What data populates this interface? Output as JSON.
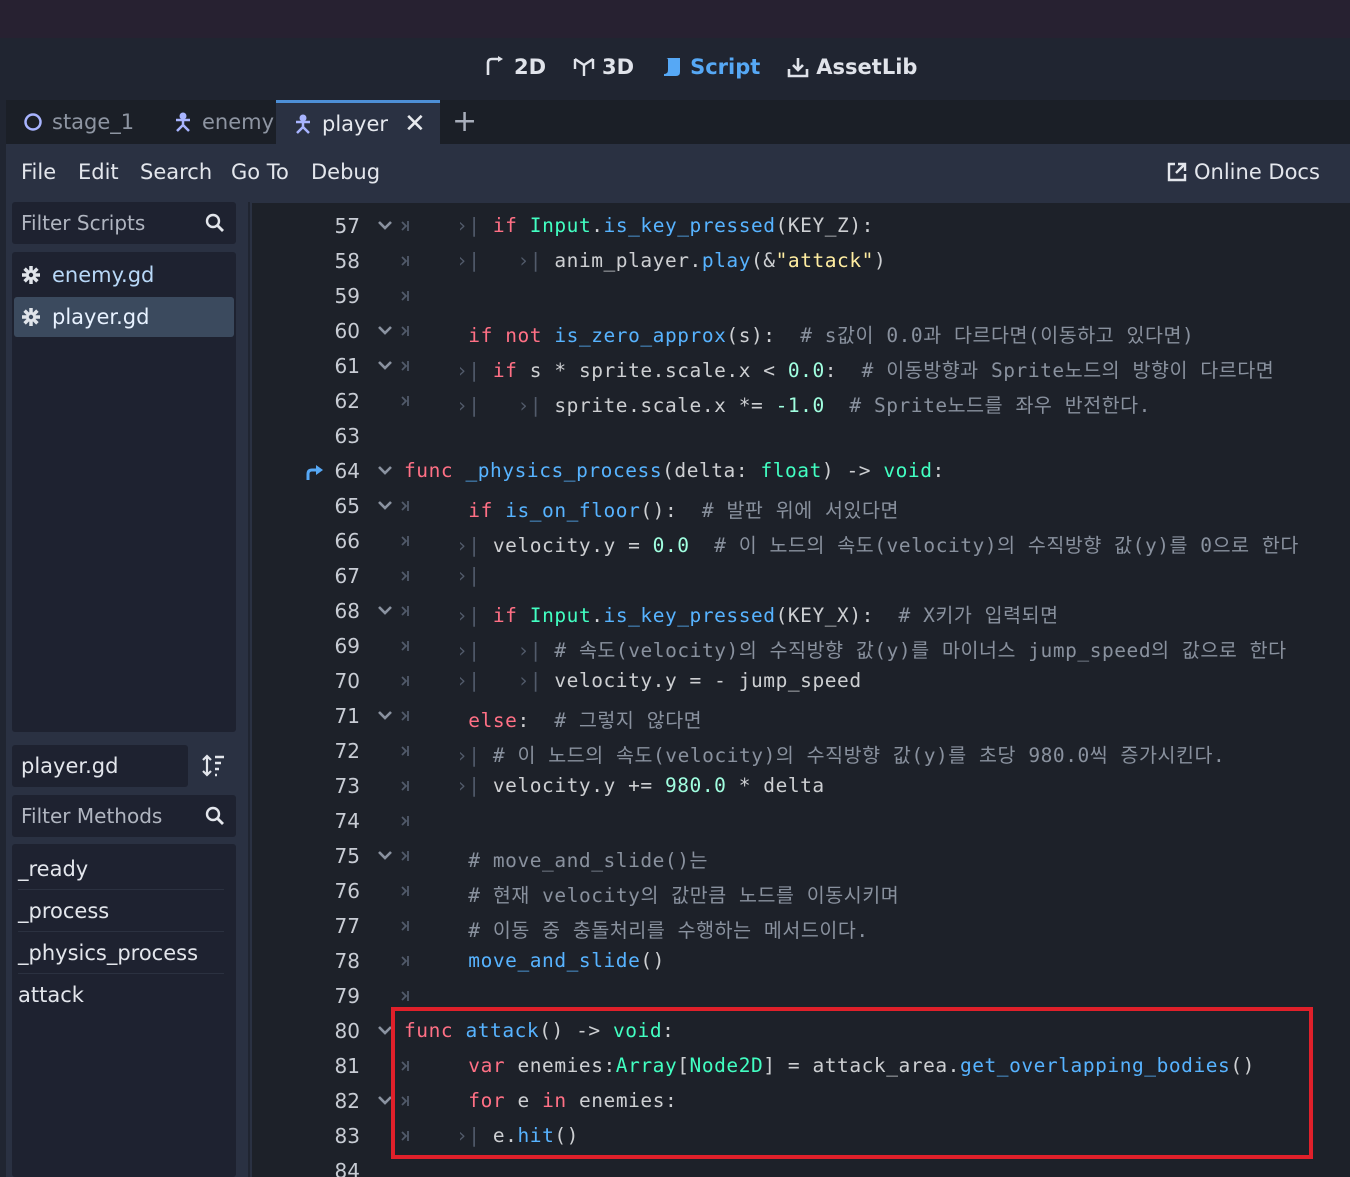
{
  "workspaces": [
    {
      "label": "2D",
      "icon": "2d-icon",
      "active": false
    },
    {
      "label": "3D",
      "icon": "3d-icon",
      "active": false
    },
    {
      "label": "Script",
      "icon": "script-icon",
      "active": true
    },
    {
      "label": "AssetLib",
      "icon": "assetlib-icon",
      "active": false
    }
  ],
  "tabs": [
    {
      "label": "stage_1",
      "icon": "node-circle-icon"
    },
    {
      "label": "enemy",
      "icon": "character-icon"
    },
    {
      "label": "player",
      "icon": "character-icon",
      "active": true,
      "close": "✕"
    }
  ],
  "tab_add": "+",
  "menu": {
    "file": "File",
    "edit": "Edit",
    "search": "Search",
    "goto": "Go To",
    "debug": "Debug",
    "online_docs": "Online Docs"
  },
  "scripts_panel": {
    "filter_placeholder": "Filter Scripts",
    "scripts": [
      {
        "name": "enemy.gd",
        "selected": false
      },
      {
        "name": "player.gd",
        "selected": true
      }
    ],
    "current_script": "player.gd",
    "methods_filter_placeholder": "Filter Methods",
    "methods": [
      "_ready",
      "_process",
      "_physics_process",
      "attack"
    ]
  },
  "editor": {
    "lines": [
      {
        "n": "57",
        "fold": true
      },
      {
        "n": "58",
        "fold": false
      },
      {
        "n": "59",
        "fold": false
      },
      {
        "n": "60",
        "fold": true
      },
      {
        "n": "61",
        "fold": true
      },
      {
        "n": "62",
        "fold": false
      },
      {
        "n": "63",
        "fold": false
      },
      {
        "n": "64",
        "fold": true,
        "breakpoint_icon": true
      },
      {
        "n": "65",
        "fold": true
      },
      {
        "n": "66",
        "fold": false
      },
      {
        "n": "67",
        "fold": false
      },
      {
        "n": "68",
        "fold": true
      },
      {
        "n": "69",
        "fold": false
      },
      {
        "n": "70",
        "fold": false
      },
      {
        "n": "71",
        "fold": true
      },
      {
        "n": "72",
        "fold": false
      },
      {
        "n": "73",
        "fold": false
      },
      {
        "n": "74",
        "fold": false
      },
      {
        "n": "75",
        "fold": true
      },
      {
        "n": "76",
        "fold": false
      },
      {
        "n": "77",
        "fold": false
      },
      {
        "n": "78",
        "fold": false
      },
      {
        "n": "79",
        "fold": false
      },
      {
        "n": "80",
        "fold": true
      },
      {
        "n": "81",
        "fold": false
      },
      {
        "n": "82",
        "fold": true
      },
      {
        "n": "83",
        "fold": false
      },
      {
        "n": "84",
        "fold": false
      }
    ],
    "code": {
      "l57": [
        "if",
        "Input",
        ".",
        "is_key_pressed",
        "(KEY_Z):"
      ],
      "l58": [
        "anim_player.",
        "play",
        "(&",
        "\"attack\"",
        ")"
      ],
      "l60": [
        "if",
        "not",
        "is_zero_approx",
        "(s):",
        "# s값이 0.0과 다르다면(이동하고 있다면)"
      ],
      "l61": [
        "if",
        "s * sprite.scale.x < ",
        "0.0",
        ":",
        "# 이동방향과 Sprite노드의 방향이 다르다면"
      ],
      "l62": [
        "sprite.scale.x *= ",
        "-1.0",
        "# Sprite노드를 좌우 반전한다."
      ],
      "l64": [
        "func",
        "_physics_process",
        "(delta: ",
        "float",
        ") -> ",
        "void",
        ":"
      ],
      "l65": [
        "if",
        "is_on_floor",
        "():",
        "# 발판 위에 서있다면"
      ],
      "l66": [
        "velocity.y = ",
        "0.0",
        "# 이 노드의 속도(velocity)의 수직방향 값(y)를 0으로 한다"
      ],
      "l68": [
        "if",
        "Input",
        ".",
        "is_key_pressed",
        "(KEY_X):",
        "# X키가 입력되면"
      ],
      "l69": [
        "# 속도(velocity)의 수직방향 값(y)를 마이너스 jump_speed의 값으로 한다"
      ],
      "l70": [
        "velocity.y = - jump_speed"
      ],
      "l71": [
        "else",
        ":",
        "# 그렇지 않다면"
      ],
      "l72": [
        "# 이 노드의 속도(velocity)의 수직방향 값(y)를 초당 980.0씩 증가시킨다."
      ],
      "l73": [
        "velocity.y += ",
        "980.0",
        " * delta"
      ],
      "l75": [
        "# move_and_slide()는"
      ],
      "l76": [
        "# 현재 velocity의 값만큼 노드를 이동시키며"
      ],
      "l77": [
        "# 이동 중 충돌처리를 수행하는 메서드이다."
      ],
      "l78": [
        "move_and_slide",
        "()"
      ],
      "l80": [
        "func",
        "attack",
        "() -> ",
        "void",
        ":"
      ],
      "l81": [
        "var",
        "enemies:",
        "Array",
        "[",
        "Node2D",
        "] = attack_area.",
        "get_overlapping_bodies",
        "()"
      ],
      "l82": [
        "for",
        "e",
        "in",
        "enemies:"
      ],
      "l83": [
        "e.",
        "hit",
        "()"
      ]
    }
  },
  "colors": {
    "keyword": "#ff7085",
    "function": "#57b3ff",
    "type": "#42ffc2",
    "number": "#a1ffe0",
    "string": "#ffeda1",
    "comment": "#89919e",
    "highlight_box": "#e0202a",
    "accent": "#56a8f5"
  }
}
